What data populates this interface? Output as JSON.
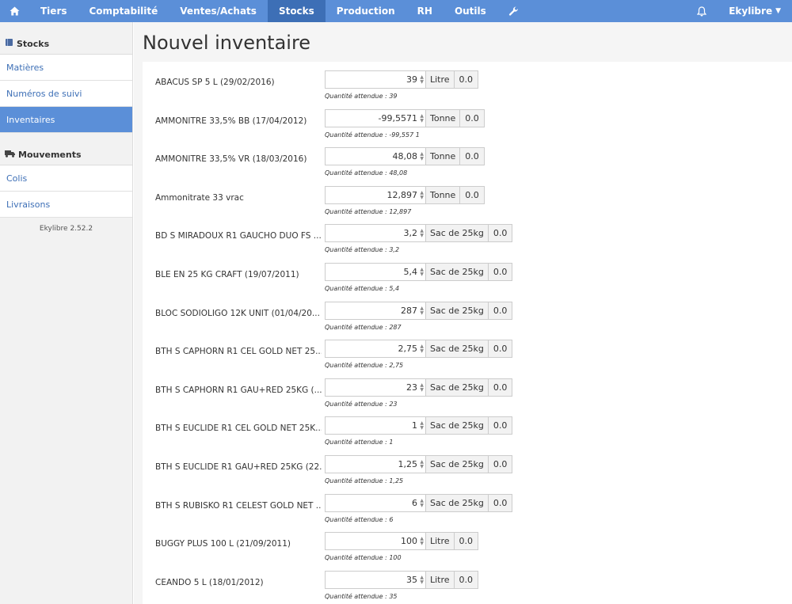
{
  "nav": {
    "items": [
      {
        "label": "Tiers"
      },
      {
        "label": "Comptabilité"
      },
      {
        "label": "Ventes/Achats"
      },
      {
        "label": "Stocks"
      },
      {
        "label": "Production"
      },
      {
        "label": "RH"
      },
      {
        "label": "Outils"
      }
    ],
    "user": "Ekylibre"
  },
  "sidebar": {
    "stocks_title": "Stocks",
    "stocks_links": [
      {
        "label": "Matières"
      },
      {
        "label": "Numéros de suivi"
      },
      {
        "label": "Inventaires"
      }
    ],
    "moves_title": "Mouvements",
    "moves_links": [
      {
        "label": "Colis"
      },
      {
        "label": "Livraisons"
      }
    ],
    "version": "Ekylibre 2.52.2"
  },
  "page": {
    "title": "Nouvel inventaire"
  },
  "items": [
    {
      "name": "ABACUS SP 5 L (29/02/2016)",
      "qty": "39",
      "unit": "Litre",
      "diff": "0.0",
      "expected": "Quantité attendue : 39"
    },
    {
      "name": "AMMONITRE 33,5% BB (17/04/2012)",
      "qty": "-99,5571",
      "unit": "Tonne",
      "diff": "0.0",
      "expected": "Quantité attendue : -99,557 1"
    },
    {
      "name": "AMMONITRE 33,5% VR (18/03/2016)",
      "qty": "48,08",
      "unit": "Tonne",
      "diff": "0.0",
      "expected": "Quantité attendue : 48,08"
    },
    {
      "name": "Ammonitrate 33 vrac",
      "qty": "12,897",
      "unit": "Tonne",
      "diff": "0.0",
      "expected": "Quantité attendue : 12,897"
    },
    {
      "name": "BD S MIRADOUX R1 GAUCHO DUO FS ...",
      "qty": "3,2",
      "unit": "Sac de 25kg",
      "diff": "0.0",
      "expected": "Quantité attendue : 3,2"
    },
    {
      "name": "BLE EN 25 KG CRAFT (19/07/2011)",
      "qty": "5,4",
      "unit": "Sac de 25kg",
      "diff": "0.0",
      "expected": "Quantité attendue : 5,4"
    },
    {
      "name": "BLOC SODIOLIGO 12K UNIT (01/04/20...",
      "qty": "287",
      "unit": "Sac de 25kg",
      "diff": "0.0",
      "expected": "Quantité attendue : 287"
    },
    {
      "name": "BTH S CAPHORN R1 CEL GOLD NET 25...",
      "qty": "2,75",
      "unit": "Sac de 25kg",
      "diff": "0.0",
      "expected": "Quantité attendue : 2,75"
    },
    {
      "name": "BTH S CAPHORN R1 GAU+RED 25KG (...",
      "qty": "23",
      "unit": "Sac de 25kg",
      "diff": "0.0",
      "expected": "Quantité attendue : 23"
    },
    {
      "name": "BTH S EUCLIDE R1 CEL GOLD NET 25K...",
      "qty": "1",
      "unit": "Sac de 25kg",
      "diff": "0.0",
      "expected": "Quantité attendue : 1"
    },
    {
      "name": "BTH S EUCLIDE R1 GAU+RED 25KG (22...",
      "qty": "1,25",
      "unit": "Sac de 25kg",
      "diff": "0.0",
      "expected": "Quantité attendue : 1,25"
    },
    {
      "name": "BTH S RUBISKO R1 CELEST GOLD NET ...",
      "qty": "6",
      "unit": "Sac de 25kg",
      "diff": "0.0",
      "expected": "Quantité attendue : 6"
    },
    {
      "name": "BUGGY PLUS 100 L (21/09/2011)",
      "qty": "100",
      "unit": "Litre",
      "diff": "0.0",
      "expected": "Quantité attendue : 100"
    },
    {
      "name": "CEANDO 5 L (18/01/2012)",
      "qty": "35",
      "unit": "Litre",
      "diff": "0.0",
      "expected": "Quantité attendue : 35"
    }
  ]
}
